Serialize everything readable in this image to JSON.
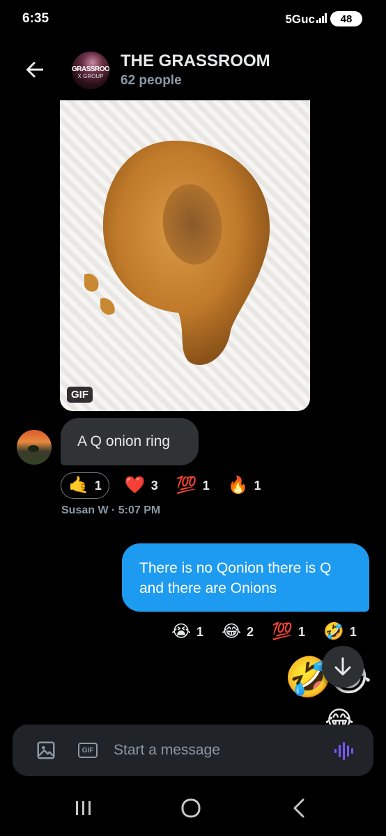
{
  "status_bar": {
    "time": "6:35",
    "network": "5Guc",
    "battery": "48"
  },
  "header": {
    "title": "THE GRASSROOM",
    "subtitle": "62 people",
    "avatar_line1": "GRASSROOM",
    "avatar_line2": "X GROUP"
  },
  "gif": {
    "badge": "GIF"
  },
  "incoming": {
    "text": "A Q onion ring",
    "sender_meta": "Susan W · 5:07 PM",
    "reactions": [
      {
        "emoji": "🤙",
        "count": "1"
      },
      {
        "emoji": "❤️",
        "count": "3"
      },
      {
        "emoji": "💯",
        "count": "1"
      },
      {
        "emoji": "🔥",
        "count": "1"
      }
    ]
  },
  "outgoing": {
    "text": "There is no Qonion there is Q and there are Onions",
    "reactions": [
      {
        "emoji": "😭",
        "count": "1"
      },
      {
        "emoji": "😂",
        "count": "2"
      },
      {
        "emoji": "💯",
        "count": "1"
      },
      {
        "emoji": "🤣",
        "count": "1"
      }
    ],
    "big_emoji_1": "🤣",
    "big_emoji_2": "😂",
    "big_emoji_3": "😂"
  },
  "composer": {
    "placeholder": "Start a message",
    "gif_label": "GIF"
  },
  "icons": {
    "back": "arrow-left-icon",
    "image": "image-icon",
    "gif": "gif-icon",
    "voice": "voice-wave-icon",
    "scroll": "arrow-down-icon",
    "nav_recents": "recents-icon",
    "nav_home": "home-icon",
    "nav_back": "back-chevron-icon"
  },
  "colors": {
    "accent": "#1d9bf0",
    "voice": "#7856ff",
    "bubble_in": "#2f3336",
    "background": "#000000"
  }
}
